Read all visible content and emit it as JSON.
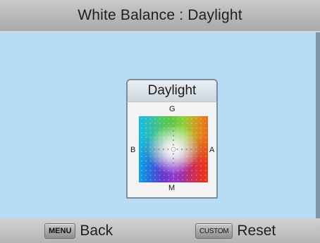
{
  "header": {
    "title": "White Balance : Daylight"
  },
  "panel": {
    "title": "Daylight",
    "axes": {
      "top": "G",
      "bottom": "M",
      "left": "B",
      "right": "A"
    },
    "gradient_colors": {
      "green": "#4cc84a",
      "yellow": "#e6e020",
      "cyan": "#18c0e0",
      "blue": "#1a2ed0",
      "magenta": "#d8208c",
      "red": "#e01818",
      "center": "#ffffff"
    }
  },
  "footer": {
    "menu": {
      "key": "MENU",
      "label": "Back"
    },
    "custom": {
      "key": "CUSTOM",
      "label": "Reset"
    }
  },
  "colors": {
    "background": "#b8dcf4",
    "header": "#b9b9b9",
    "footer": "#c4c4c4"
  }
}
